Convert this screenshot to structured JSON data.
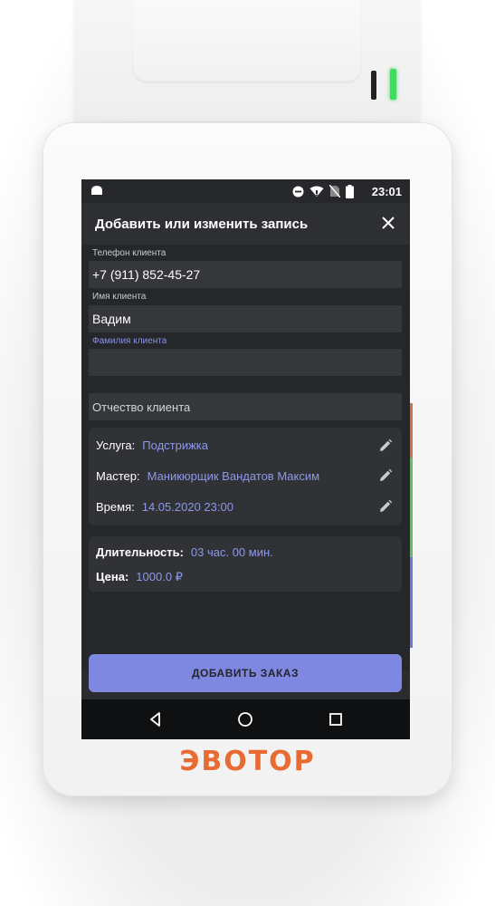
{
  "device": {
    "brand_logo": "ЭВОТОР"
  },
  "status_bar": {
    "time": "23:01",
    "icons": [
      "android-icon",
      "do-not-disturb-icon",
      "wifi-icon",
      "no-sim-icon",
      "battery-icon"
    ]
  },
  "dialog": {
    "title": "Добавить или изменить запись"
  },
  "form": {
    "phone": {
      "label": "Телефон клиента",
      "value": "+7 (911) 852-45-27"
    },
    "name": {
      "label": "Имя клиента",
      "value": "Вадим"
    },
    "surname": {
      "label": "Фамилия клиента",
      "value": ""
    },
    "patronymic": {
      "placeholder": "Отчество клиента"
    }
  },
  "booking": {
    "service": {
      "label": "Услуга:",
      "value": "Подстрижка"
    },
    "master": {
      "label": "Мастер:",
      "value": "Маникюрщик Вандатов Максим"
    },
    "time": {
      "label": "Время:",
      "value": "14.05.2020 23:00"
    }
  },
  "summary": {
    "duration": {
      "label": "Длительность:",
      "value": "03 час. 00 мин."
    },
    "price": {
      "label": "Цена:",
      "value": "1000.0 ₽"
    }
  },
  "actions": {
    "add_order": "ДОБАВИТЬ ЗАКАЗ"
  },
  "colors": {
    "accent": "#7f88e0",
    "value_text": "#8e98e8",
    "logo": "#e86b34",
    "led": "#3adf5c"
  }
}
